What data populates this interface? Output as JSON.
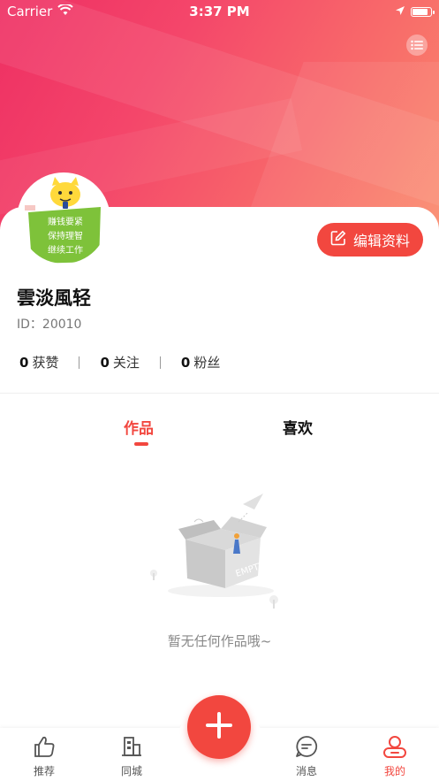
{
  "status_bar": {
    "carrier": "Carrier",
    "time": "3:37 PM"
  },
  "profile": {
    "avatar_text": [
      "赚钱要紧",
      "保持理智",
      "继续工作"
    ],
    "edit_label": "编辑资料",
    "username": "雲淡風轻",
    "id_label": "ID：20010"
  },
  "stats": [
    {
      "num": "0",
      "label": "获赞"
    },
    {
      "num": "0",
      "label": "关注"
    },
    {
      "num": "0",
      "label": "粉丝"
    }
  ],
  "tabs": {
    "works": "作品",
    "likes": "喜欢"
  },
  "empty": {
    "box_label": "EMPTY",
    "message": "暂无任何作品哦~"
  },
  "tabbar": {
    "items": [
      {
        "label": "推荐",
        "icon": "thumbs-up-icon"
      },
      {
        "label": "同城",
        "icon": "building-icon"
      },
      {
        "label": "消息",
        "icon": "chat-bubble-icon"
      },
      {
        "label": "我的",
        "icon": "person-icon"
      }
    ],
    "add_icon": "plus-icon"
  },
  "colors": {
    "accent": "#f2473f",
    "header_start": "#ee2f63",
    "header_end": "#fa8a6c"
  }
}
